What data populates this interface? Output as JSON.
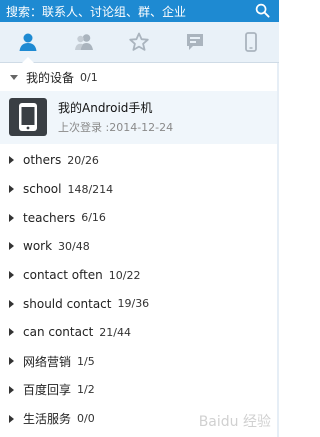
{
  "search": {
    "placeholder": "搜索：联系人、讨论组、群、企业"
  },
  "tabs": [
    {
      "name": "contacts",
      "icon": "person-icon",
      "active": true
    },
    {
      "name": "groups",
      "icon": "people-icon",
      "active": false
    },
    {
      "name": "favorites",
      "icon": "star-icon",
      "active": false
    },
    {
      "name": "messages",
      "icon": "chat-bubble-icon",
      "active": false
    },
    {
      "name": "devices",
      "icon": "phone-icon",
      "active": false
    }
  ],
  "my_devices": {
    "label": "我的设备",
    "count": "0/1",
    "device": {
      "name": "我的Android手机",
      "last_login": "上次登录 :2014-12-24"
    }
  },
  "groups": [
    {
      "name": "others",
      "count": "20/26"
    },
    {
      "name": "school",
      "count": "148/214"
    },
    {
      "name": "teachers",
      "count": "6/16"
    },
    {
      "name": "work",
      "count": "30/48"
    },
    {
      "name": "contact often",
      "count": "10/22"
    },
    {
      "name": "should contact",
      "count": "19/36"
    },
    {
      "name": "can contact",
      "count": "21/44"
    },
    {
      "name": "网络营销",
      "count": "1/5"
    },
    {
      "name": "百度回享",
      "count": "1/2"
    },
    {
      "name": "生活服务",
      "count": "0/0"
    }
  ],
  "colors": {
    "accent": "#1e8ad2",
    "active_tab_icon": "#1e8ad2",
    "inactive_tab_icon": "#aab4be"
  },
  "watermark": "Baidu 经验"
}
